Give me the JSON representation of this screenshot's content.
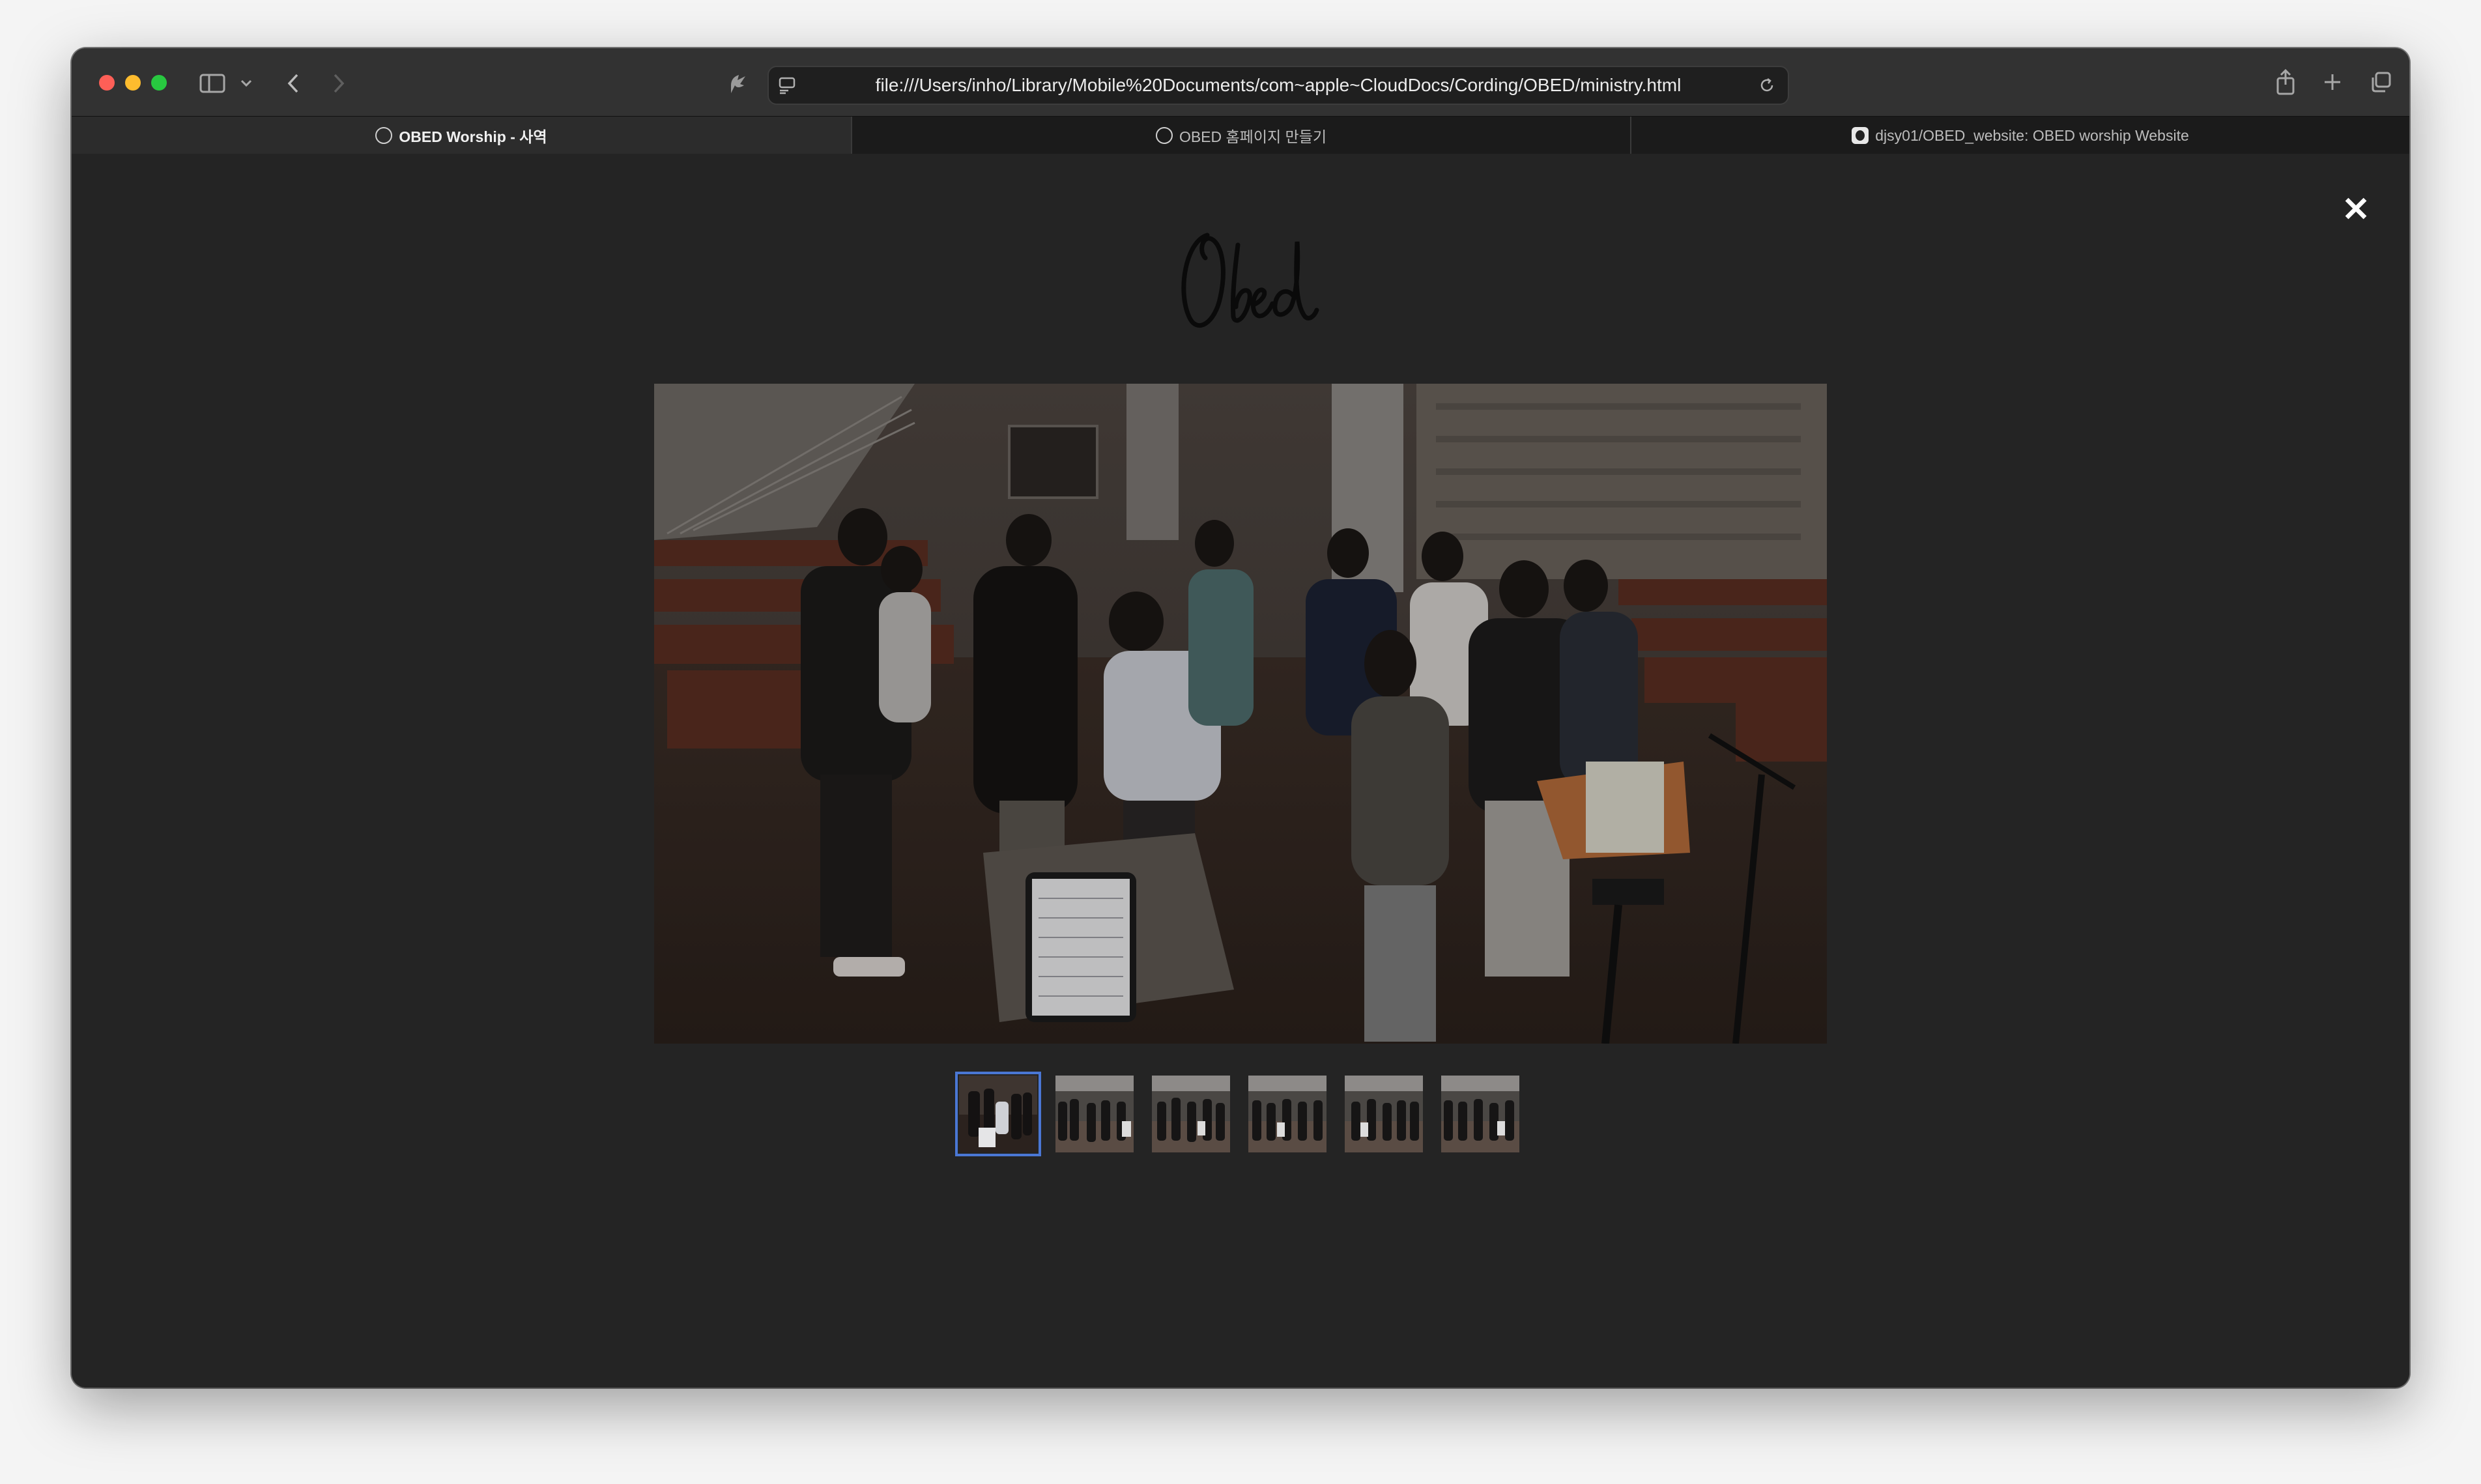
{
  "browser": {
    "url": "file:///Users/inho/Library/Mobile%20Documents/com~apple~CloudDocs/Cording/OBED/ministry.html",
    "tabs": [
      {
        "label": "OBED Worship - 사역",
        "icon": "compass-icon",
        "active": true
      },
      {
        "label": "OBED 홈페이지 만들기",
        "icon": "openai-icon",
        "active": false
      },
      {
        "label": "djsy01/OBED_website: OBED worship Website",
        "icon": "github-icon",
        "active": false
      }
    ],
    "toolbar_icons": [
      "sidebar-icon",
      "chevron-down-icon",
      "back-icon",
      "forward-icon",
      "extension-icon",
      "reader-icon",
      "reload-icon",
      "share-icon",
      "new-tab-icon",
      "tab-overview-icon"
    ]
  },
  "page": {
    "logo_text": "Obed",
    "close_glyph": "✕",
    "gallery": {
      "selected_index": 0,
      "thumbnail_count": 6,
      "main_image_description": "worship team praying in a circle in a church hall"
    }
  },
  "colors": {
    "page_bg": "#242424",
    "titlebar": "#323232",
    "active_thumb_border": "#4a77d4"
  }
}
